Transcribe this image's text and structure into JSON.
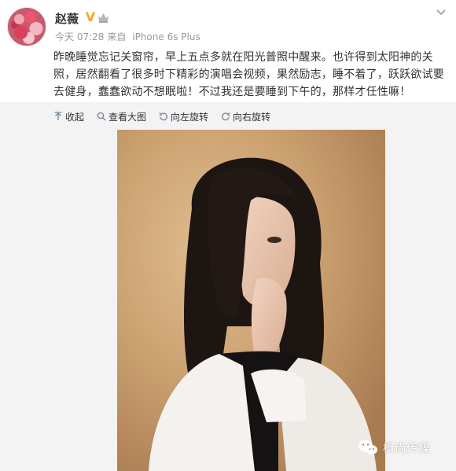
{
  "user": {
    "name": "赵薇",
    "verified_badge": "V",
    "avatar": "avatar-roses",
    "badge_icon": "crown-icon"
  },
  "meta": {
    "time": "今天 07:28",
    "source_prefix": "来自",
    "source": "iPhone 6s Plus"
  },
  "post": {
    "text": "昨晚睡觉忘记关窗帘，早上五点多就在阳光普照中醒来。也许得到太阳神的关照，居然翻看了很多时下精彩的演唱会视频，果然励志，睡不着了，跃跃欲试要去健身，蠢蠢欲动不想眠啦！不过我还是要睡到下午的，那样才任性嘛！"
  },
  "toolbar": {
    "collapse": "收起",
    "view_large": "查看大图",
    "rotate_left": "向左旋转",
    "rotate_right": "向右旋转"
  },
  "watermark": {
    "text": "枫尚传媒",
    "icon": "wechat-icon"
  },
  "colors": {
    "verified": "#f5a623",
    "meta": "#999999",
    "media_bg": "#f3f3f3",
    "photo_bg": "#cca072"
  }
}
